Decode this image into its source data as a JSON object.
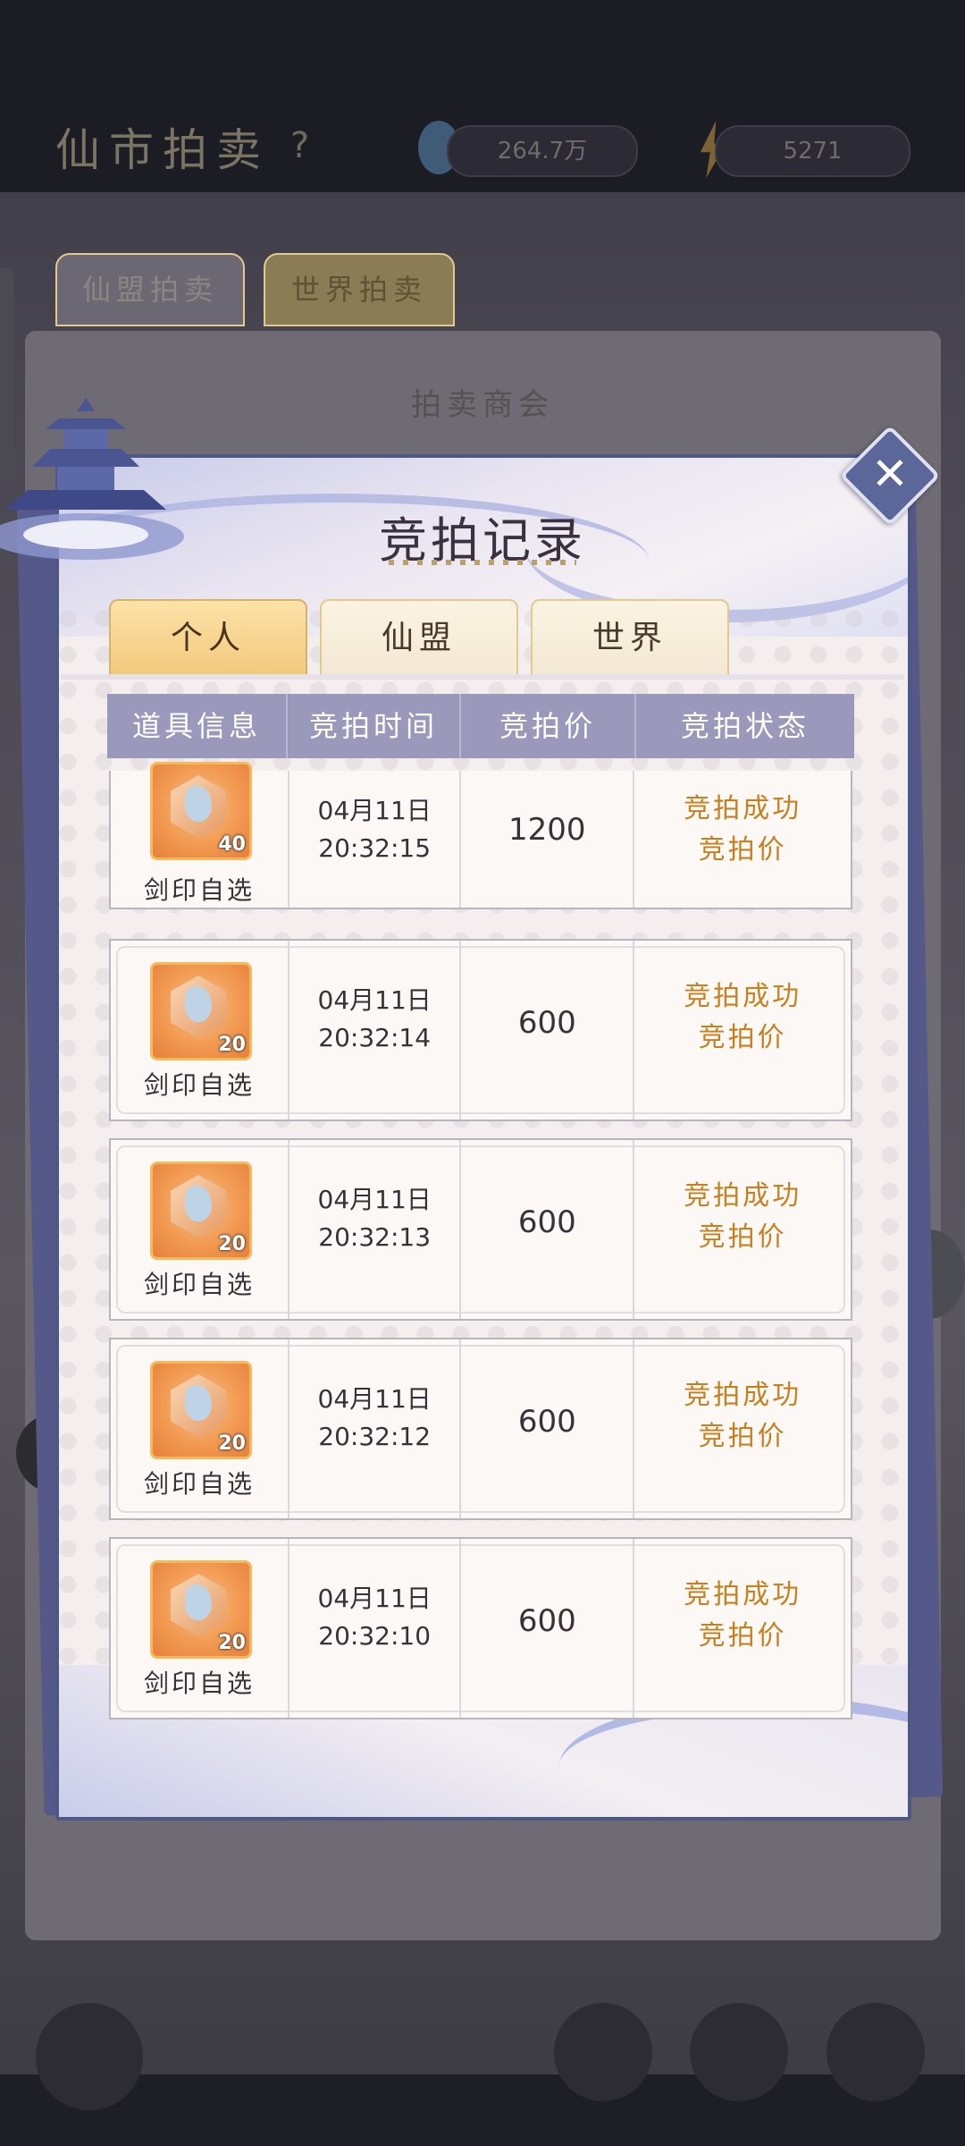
{
  "background": {
    "title": "仙市拍卖",
    "help": "?",
    "resource1": "264.7万",
    "resource2": "5271",
    "tabs": [
      "仙盟拍卖",
      "世界拍卖"
    ],
    "panel_header": "拍卖商会"
  },
  "modal": {
    "title": "竞拍记录",
    "close_label": "✕",
    "tabs": [
      {
        "label": "个人",
        "active": true
      },
      {
        "label": "仙盟",
        "active": false
      },
      {
        "label": "世界",
        "active": false
      }
    ],
    "columns": [
      "道具信息",
      "竞拍时间",
      "竞拍价",
      "竞拍状态"
    ],
    "records": [
      {
        "item_name": "剑印自选",
        "count": "40",
        "date": "04月11日",
        "time": "20:32:15",
        "price": "1200",
        "status_line1": "竞拍成功",
        "status_line2": "竞拍价"
      },
      {
        "item_name": "剑印自选",
        "count": "20",
        "date": "04月11日",
        "time": "20:32:14",
        "price": "600",
        "status_line1": "竞拍成功",
        "status_line2": "竞拍价"
      },
      {
        "item_name": "剑印自选",
        "count": "20",
        "date": "04月11日",
        "time": "20:32:13",
        "price": "600",
        "status_line1": "竞拍成功",
        "status_line2": "竞拍价"
      },
      {
        "item_name": "剑印自选",
        "count": "20",
        "date": "04月11日",
        "time": "20:32:12",
        "price": "600",
        "status_line1": "竞拍成功",
        "status_line2": "竞拍价"
      },
      {
        "item_name": "剑印自选",
        "count": "20",
        "date": "04月11日",
        "time": "20:32:10",
        "price": "600",
        "status_line1": "竞拍成功",
        "status_line2": "竞拍价"
      }
    ]
  },
  "colors": {
    "accent_status": "#c7801f",
    "header_bg": "#9a98bb",
    "active_tab": "#f2c97c",
    "frame": "#4f5785"
  }
}
